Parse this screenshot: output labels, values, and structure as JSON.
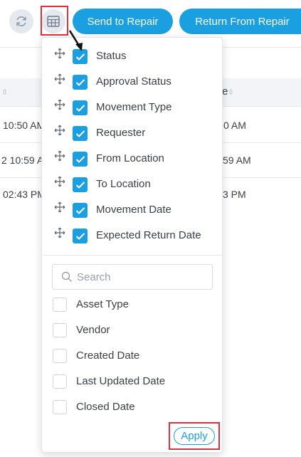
{
  "toolbar": {
    "send_to_repair": "Send to Repair",
    "return_from_repair": "Return From Repair",
    "refresh_icon": "refresh-icon",
    "columns_icon": "table-columns-icon"
  },
  "background_table": {
    "header_fragment": "e",
    "rows": [
      {
        "left": "10:50 AM",
        "right": "0 AM"
      },
      {
        "left": "2 10:59 A",
        "right": "59 AM"
      },
      {
        "left": "02:43 PM",
        "right": "3 PM"
      }
    ]
  },
  "column_chooser": {
    "selected": [
      {
        "label": "Status",
        "checked": true
      },
      {
        "label": "Approval Status",
        "checked": true
      },
      {
        "label": "Movement Type",
        "checked": true
      },
      {
        "label": "Requester",
        "checked": true
      },
      {
        "label": "From Location",
        "checked": true
      },
      {
        "label": "To Location",
        "checked": true
      },
      {
        "label": "Movement Date",
        "checked": true
      },
      {
        "label": "Expected Return Date",
        "checked": true
      }
    ],
    "search": {
      "placeholder": "Search",
      "value": ""
    },
    "available": [
      {
        "label": "Asset Type",
        "checked": false
      },
      {
        "label": "Vendor",
        "checked": false
      },
      {
        "label": "Created Date",
        "checked": false
      },
      {
        "label": "Last Updated Date",
        "checked": false
      },
      {
        "label": "Closed Date",
        "checked": false
      }
    ],
    "apply_label": "Apply"
  },
  "colors": {
    "accent": "#1a9fe0",
    "highlight": "#e0313b"
  }
}
